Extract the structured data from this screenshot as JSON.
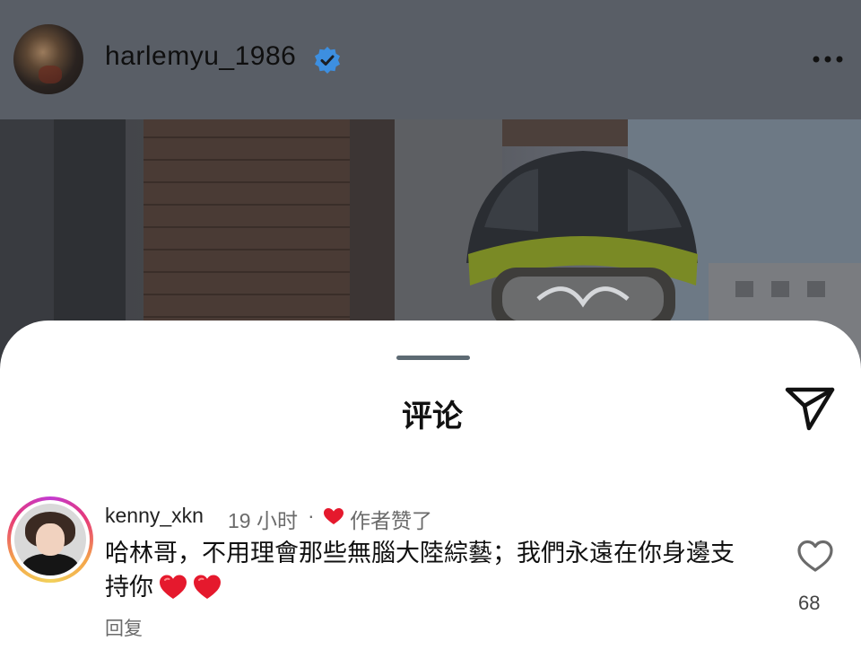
{
  "post": {
    "username": "harlemyu_1986",
    "verified_icon": "verified-badge-icon",
    "more_icon": "more-dots-icon"
  },
  "comments_sheet": {
    "title": "评论",
    "send_icon": "send-icon"
  },
  "comment": {
    "username": "kenny_xkn",
    "time": "19 小时",
    "separator": "·",
    "liked_by_author": "作者赞了",
    "text": "哈林哥，不用理會那些無腦大陸綜藝；我們永遠在你身邊支持你",
    "emoji": "❤️❤️",
    "reply_label": "回复",
    "like_count": "68"
  },
  "colors": {
    "verified": "#3d8fe0",
    "heart_red": "#e5192d",
    "sheet_bg": "#ffffff"
  }
}
